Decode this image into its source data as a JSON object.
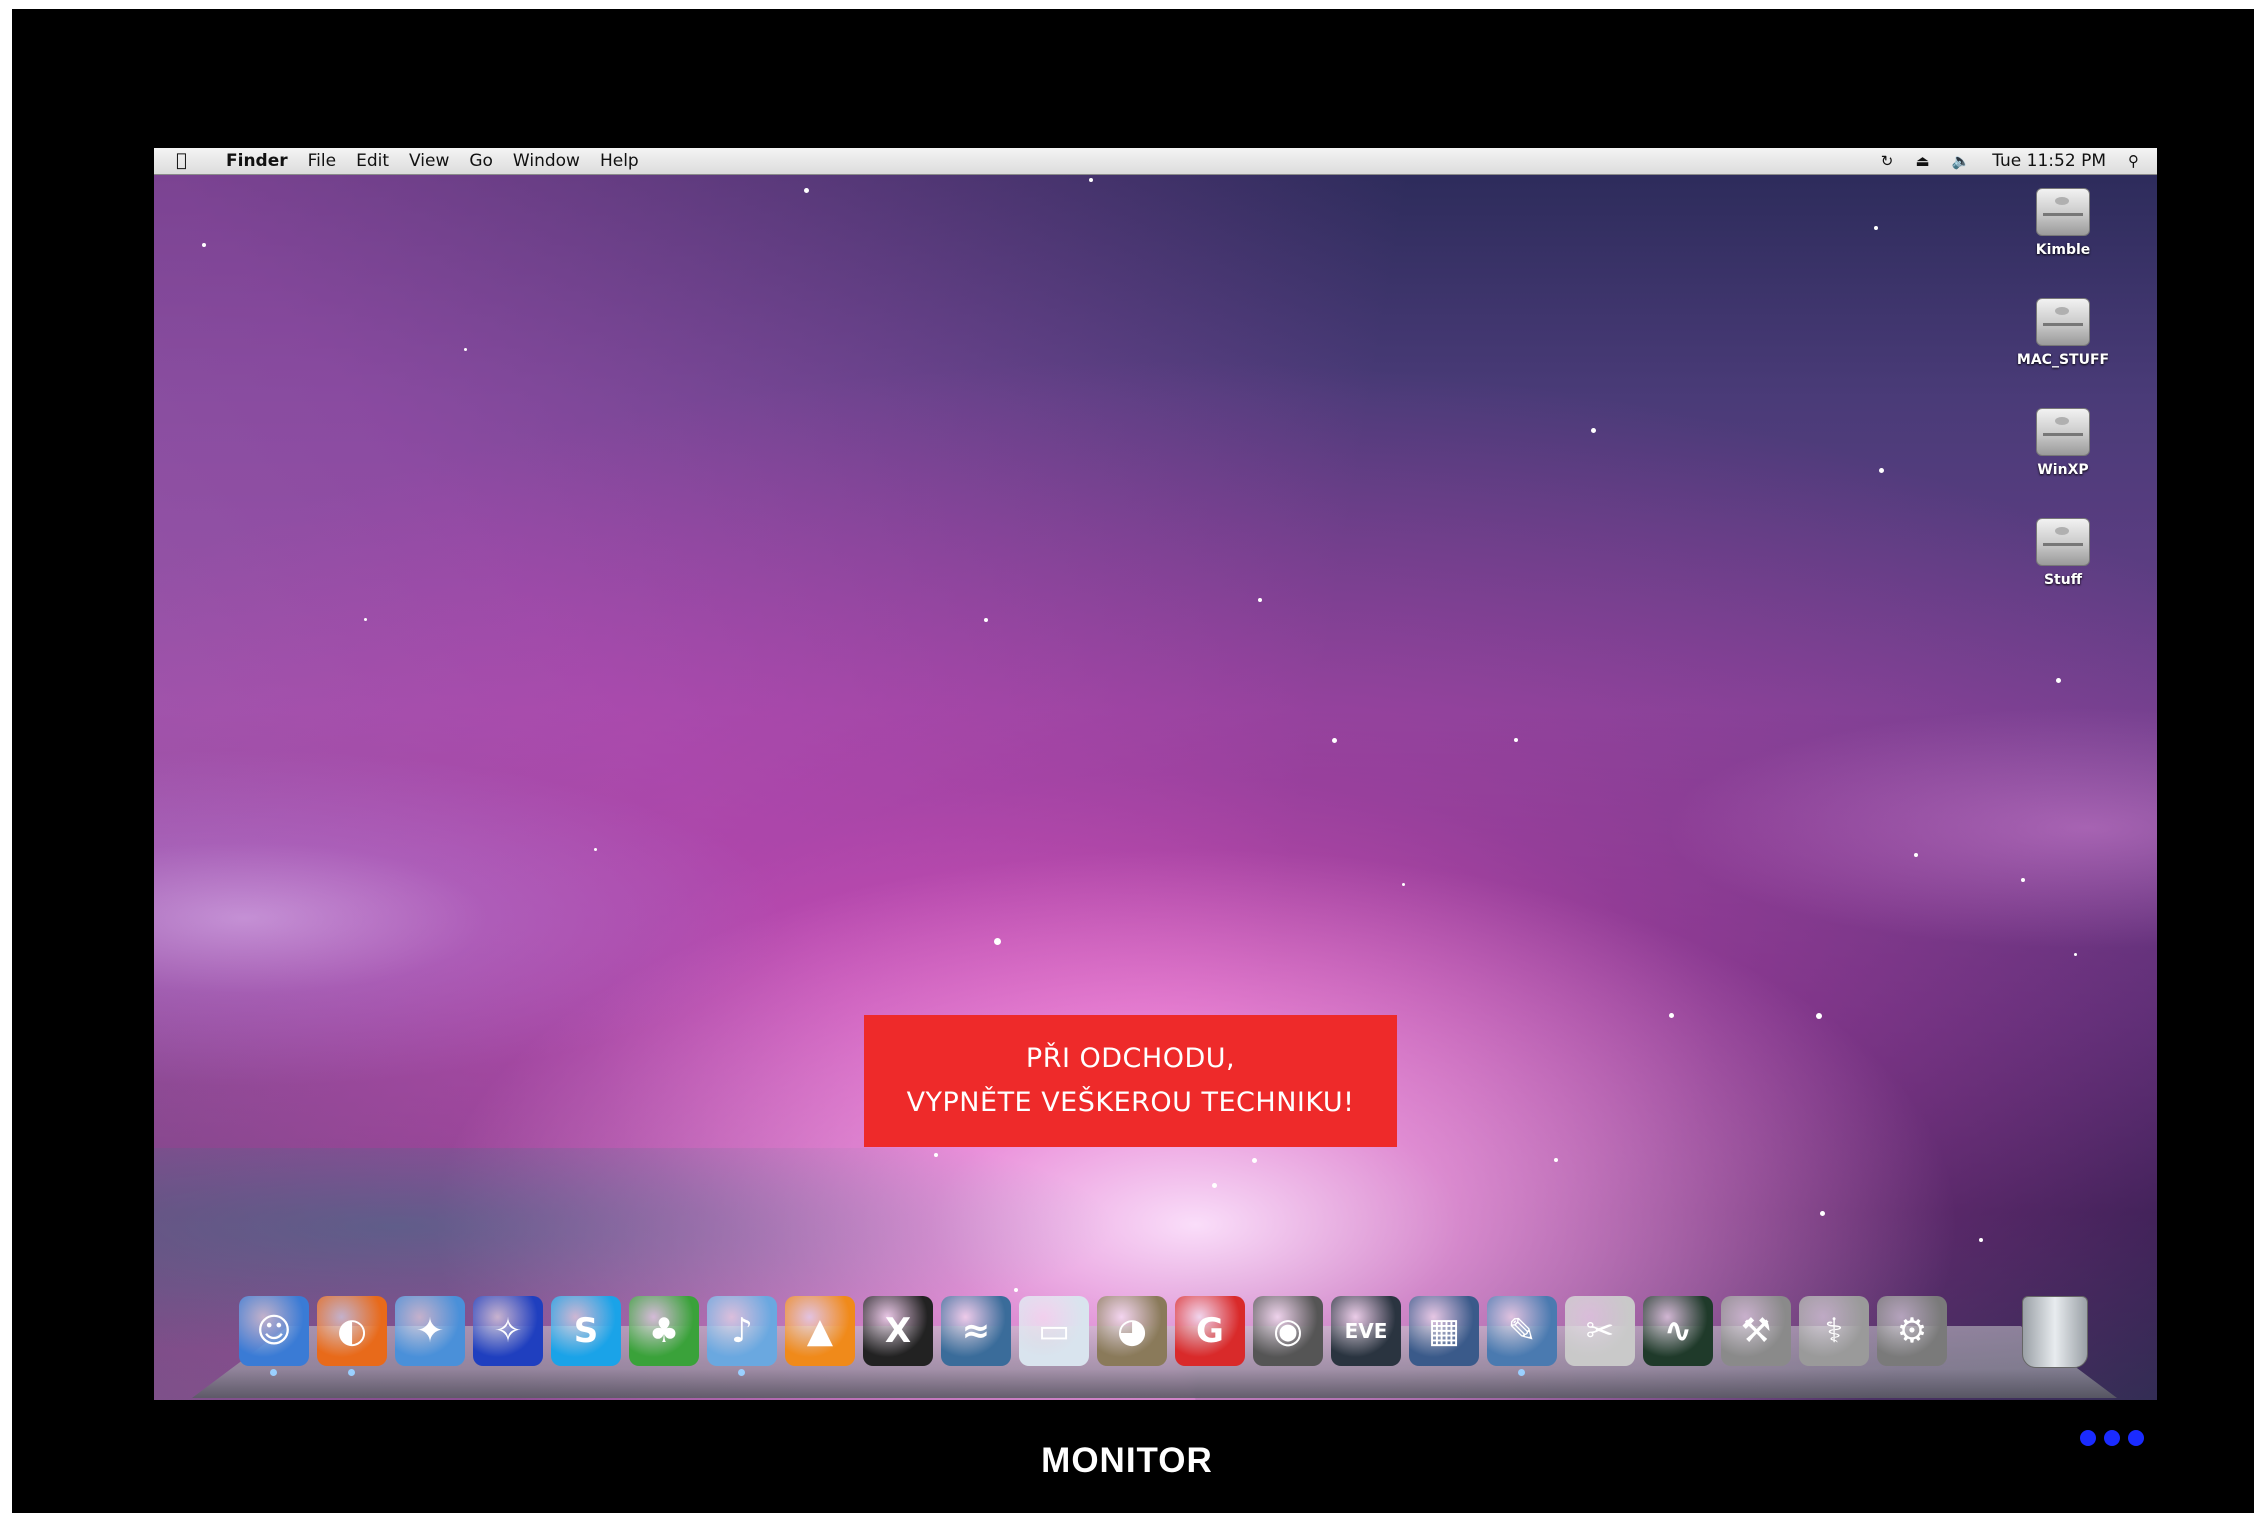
{
  "menubar": {
    "apple_icon": "apple-logo",
    "app_name": "Finder",
    "items": [
      "File",
      "Edit",
      "View",
      "Go",
      "Window",
      "Help"
    ],
    "status_icons": [
      "time-machine-icon",
      "eject-icon",
      "volume-icon"
    ],
    "clock": "Tue 11:52 PM",
    "search_icon": "spotlight-icon"
  },
  "desktop": {
    "drives": [
      "Kimble",
      "MAC_STUFF",
      "WinXP",
      "Stuff"
    ]
  },
  "dock": {
    "apps": [
      {
        "name": "finder",
        "glyph": "☺",
        "color": "#3a7bd5"
      },
      {
        "name": "firefox",
        "glyph": "◐",
        "color": "#e86a1a"
      },
      {
        "name": "safari",
        "glyph": "✦",
        "color": "#4a90d9"
      },
      {
        "name": "frog",
        "glyph": "✧",
        "color": "#1f3fbf"
      },
      {
        "name": "skype",
        "glyph": "S",
        "color": "#1aa3e8"
      },
      {
        "name": "adium",
        "glyph": "♣",
        "color": "#3aa23a"
      },
      {
        "name": "itunes",
        "glyph": "♪",
        "color": "#6aa8e0"
      },
      {
        "name": "vlc",
        "glyph": "▲",
        "color": "#f08a1a"
      },
      {
        "name": "x11",
        "glyph": "X",
        "color": "#222222"
      },
      {
        "name": "openoffice",
        "glyph": "≈",
        "color": "#3a6c9a"
      },
      {
        "name": "toast",
        "glyph": "▭",
        "color": "#d9e4ee"
      },
      {
        "name": "gimp",
        "glyph": "◕",
        "color": "#8a7a5a"
      },
      {
        "name": "app-red",
        "glyph": "G",
        "color": "#d92a2a"
      },
      {
        "name": "app-eye",
        "glyph": "◉",
        "color": "#555555"
      },
      {
        "name": "eve-online",
        "glyph": "EVE",
        "color": "#2a3440"
      },
      {
        "name": "spaces",
        "glyph": "▦",
        "color": "#3a5a8a"
      },
      {
        "name": "system-tool",
        "glyph": "✎",
        "color": "#4a7ab0"
      },
      {
        "name": "utility",
        "glyph": "✂",
        "color": "#c9c9c9"
      },
      {
        "name": "activity-monitor",
        "glyph": "∿",
        "color": "#1f3a2a"
      },
      {
        "name": "directory-utility",
        "glyph": "⚒",
        "color": "#8a8a8a"
      },
      {
        "name": "disk-utility",
        "glyph": "⚕",
        "color": "#9a9a9a"
      },
      {
        "name": "system-preferences",
        "glyph": "⚙",
        "color": "#7a7a7a"
      }
    ],
    "trash": "trash-icon"
  },
  "notice": {
    "line1": "PŘI ODCHODU,",
    "line2": "VYPNĚTE VEŠKEROU TECHNIKU!"
  },
  "caption": "MONITOR"
}
